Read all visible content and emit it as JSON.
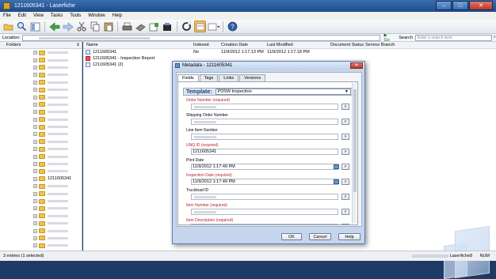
{
  "window": {
    "title": "1211605341 - Laserfiche",
    "min": "–",
    "max": "□",
    "close": "✕"
  },
  "menu": [
    "File",
    "Edit",
    "View",
    "Tasks",
    "Tools",
    "Window",
    "Help"
  ],
  "toolbar": {
    "icons": [
      "folder-open-icon",
      "search-icon",
      "view-icon",
      "back-icon",
      "forward-icon",
      "cut-icon",
      "copy-icon",
      "paste-icon",
      "print-icon",
      "scan-icon",
      "import-icon",
      "export-icon",
      "refresh-icon",
      "thumbnail-view-icon",
      "details-view-icon",
      "help-icon"
    ]
  },
  "location": {
    "label": "Location:",
    "go_label": "Go",
    "search_label": "Search",
    "search_placeholder": "Enter a search term"
  },
  "folders": {
    "header": "Folders",
    "close": "x",
    "visible_label": "1211605341"
  },
  "list": {
    "columns": {
      "name": "Name",
      "indexed": "Indexed",
      "creation_date": "Creation Date",
      "last_modified": "Last Modified",
      "document_status": "Document Status",
      "service_branch": "Service Branch"
    },
    "rows": [
      {
        "name": "1211605341",
        "indexed": "No",
        "created": "11/9/2012 1:17:13 PM",
        "modified": "11/9/2012 1:17:18 PM"
      },
      {
        "name": "1211605341 - Inspection Report",
        "indexed": "",
        "created": "",
        "modified": ""
      },
      {
        "name": "1211605341 (2)",
        "indexed": "",
        "created": "",
        "modified": ""
      }
    ]
  },
  "status": {
    "left": "3 entries (1 selected)",
    "right": "Laserfiche8",
    "num": "NUM"
  },
  "dialog": {
    "title": "Metadata - 1211605341",
    "close": "✕",
    "tabs": [
      "Fields",
      "Tags",
      "Links",
      "Versions"
    ],
    "template_label": "Template:",
    "template_value": "PDSW Inspection",
    "fields": [
      {
        "label": "Order Number (required)",
        "value": "",
        "required": true
      },
      {
        "label": "Shipping Order Number",
        "value": "",
        "required": false
      },
      {
        "label": "Line Item Number",
        "value": "",
        "required": false
      },
      {
        "label": "UNQ ID (required)",
        "value": "1211605341",
        "required": true
      },
      {
        "label": "Print Date",
        "value": "11/9/2012 1:17:49 PM",
        "required": false
      },
      {
        "label": "Inspection Date (required)",
        "value": "11/9/2012 1:17:49 PM",
        "required": true
      },
      {
        "label": "Truckload ID",
        "value": "",
        "required": false
      },
      {
        "label": "Item Number (required)",
        "value": "",
        "required": true
      },
      {
        "label": "Item Description (required)",
        "value": "",
        "required": true
      }
    ],
    "field_button": ">",
    "buttons": {
      "ok": "OK",
      "cancel": "Cancel",
      "help": "Help"
    }
  }
}
